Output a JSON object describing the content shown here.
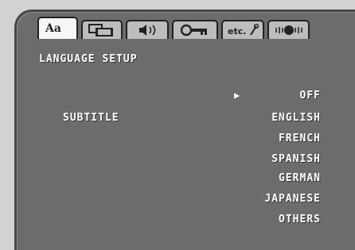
{
  "tabs": [
    {
      "icon": "language-icon",
      "label": "Aa"
    },
    {
      "icon": "display-icon",
      "label": ""
    },
    {
      "icon": "audio-icon",
      "label": ""
    },
    {
      "icon": "key-icon",
      "label": ""
    },
    {
      "icon": "misc-tools-icon",
      "label": "etc."
    },
    {
      "icon": "speaker-icon",
      "label": ""
    }
  ],
  "section_title": "LANGUAGE SETUP",
  "subtitle_label": "SUBTITLE",
  "selection_marker": "▶",
  "options": [
    "OFF",
    "ENGLISH",
    "FRENCH",
    "SPANISH",
    "GERMAN",
    "JAPANESE",
    "OTHERS"
  ],
  "selected_option": "OFF"
}
